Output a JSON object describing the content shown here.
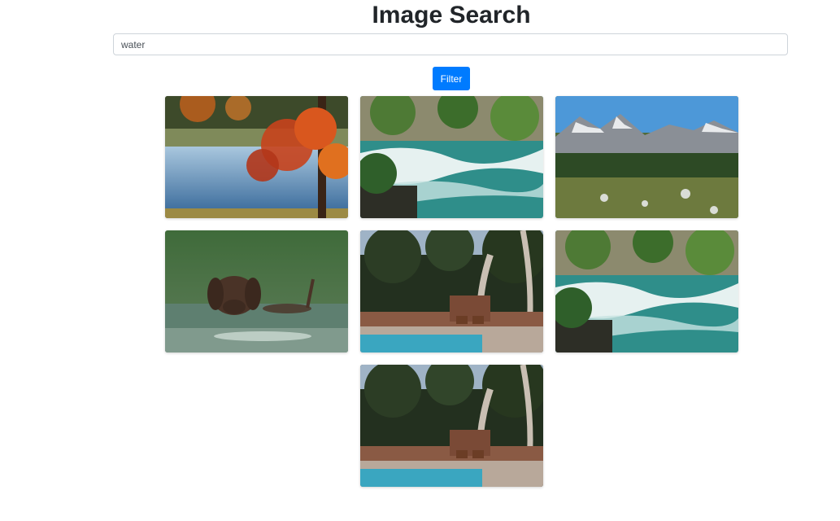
{
  "header": {
    "title": "Image Search"
  },
  "search": {
    "value": "water",
    "placeholder": ""
  },
  "toolbar": {
    "filter_label": "Filter"
  },
  "results": [
    {
      "subject": "autumn-lake"
    },
    {
      "subject": "river-rapids"
    },
    {
      "subject": "mountain-meadow"
    },
    {
      "subject": "swimming-dog"
    },
    {
      "subject": "pool-deck"
    },
    {
      "subject": "river-rapids"
    },
    {
      "subject": "pool-deck"
    }
  ],
  "colors": {
    "accent": "#007bff",
    "text": "#212529",
    "border": "#ced4da"
  }
}
